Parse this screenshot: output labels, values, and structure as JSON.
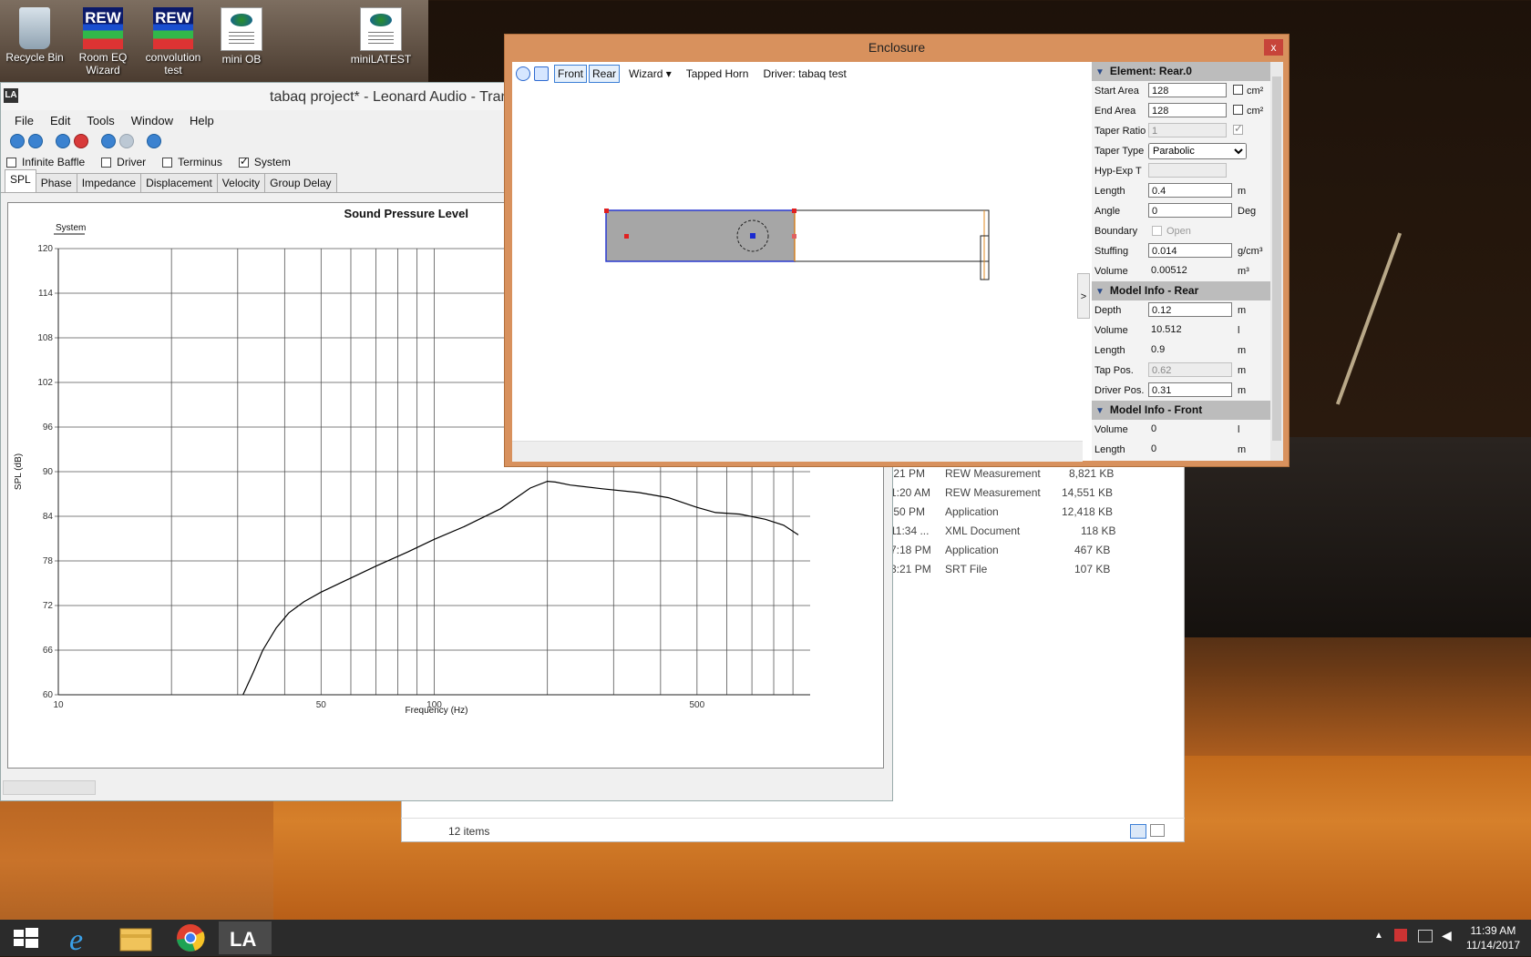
{
  "desktop": {
    "icons": [
      {
        "label": "Recycle Bin",
        "icon": "recycle-bin-icon"
      },
      {
        "label": "Room EQ Wizard",
        "icon": "rew-icon",
        "badge": "REW"
      },
      {
        "label": "convolution test",
        "icon": "rew-icon",
        "badge": "REW"
      },
      {
        "label": "mini OB",
        "icon": "xml-document-icon"
      },
      {
        "label": "miniLATEST",
        "icon": "xml-document-icon"
      }
    ]
  },
  "main_window": {
    "title": "tabaq project* - Leonard Audio - Trans",
    "app_icon_text": "LA",
    "menu": [
      "File",
      "Edit",
      "Tools",
      "Window",
      "Help"
    ],
    "checkboxes": [
      {
        "label": "Infinite Baffle",
        "checked": false
      },
      {
        "label": "Driver",
        "checked": false
      },
      {
        "label": "Terminus",
        "checked": false
      },
      {
        "label": "System",
        "checked": true
      }
    ],
    "tabs": [
      "SPL",
      "Phase",
      "Impedance",
      "Displacement",
      "Velocity",
      "Group Delay"
    ],
    "active_tab": "SPL",
    "chart": {
      "title": "Sound Pressure Level",
      "legend": "System",
      "ylabel": "SPL (dB)",
      "xlabel": "Frequency (Hz)"
    }
  },
  "chart_data": {
    "type": "line",
    "title": "Sound Pressure Level",
    "xlabel": "Frequency (Hz)",
    "ylabel": "SPL (dB)",
    "xscale": "log",
    "xlim": [
      10,
      1000
    ],
    "ylim": [
      60,
      120
    ],
    "yticks": [
      60,
      66,
      72,
      78,
      84,
      90,
      96,
      102,
      108,
      114,
      120
    ],
    "xtick_labels": [
      "10",
      "50",
      "100",
      "500"
    ],
    "legend_position": "top-left",
    "grid": true,
    "series": [
      {
        "name": "System",
        "color": "#000000",
        "x": [
          31,
          33,
          35,
          38,
          41,
          45,
          50,
          60,
          70,
          85,
          100,
          120,
          150,
          180,
          200,
          210,
          230,
          280,
          350,
          420,
          500,
          560,
          650,
          760,
          850,
          930
        ],
        "y": [
          60,
          63,
          66,
          69,
          71,
          72.5,
          73.8,
          75.7,
          77.3,
          79.2,
          80.9,
          82.6,
          85,
          87.8,
          88.7,
          88.6,
          88.2,
          87.7,
          87.2,
          86.5,
          85.2,
          84.5,
          84.3,
          83.6,
          82.8,
          81.5
        ]
      }
    ]
  },
  "enclosure": {
    "title": "Enclosure",
    "close": "x",
    "toolbar": {
      "front": "Front",
      "rear": "Rear",
      "wizard": "Wizard",
      "tapped_horn": "Tapped Horn",
      "driver": "Driver: tabaq test"
    },
    "collapse": ">",
    "element_section": "Element: Rear.0",
    "element_props": [
      {
        "label": "Start Area",
        "value": "128",
        "unit": "cm²",
        "checkbox": true,
        "checked": false
      },
      {
        "label": "End Area",
        "value": "128",
        "unit": "cm²",
        "checkbox": true,
        "checked": false
      },
      {
        "label": "Taper Ratio",
        "value": "1",
        "readonly": true,
        "checkbox": true,
        "checked": true
      },
      {
        "label": "Taper Type",
        "value": "Parabolic",
        "select": true
      },
      {
        "label": "Hyp-Exp T",
        "value": "",
        "readonly": true
      },
      {
        "label": "Length",
        "value": "0.4",
        "unit": "m"
      },
      {
        "label": "Angle",
        "value": "0",
        "unit": "Deg"
      },
      {
        "label": "Boundary",
        "value": "Open",
        "boundary": true
      },
      {
        "label": "Stuffing",
        "value": "0.014",
        "unit": "g/cm³"
      },
      {
        "label": "Volume",
        "value": "0.00512",
        "unit": "m³",
        "plain": true
      }
    ],
    "rear_section": "Model Info - Rear",
    "rear_props": [
      {
        "label": "Depth",
        "value": "0.12",
        "unit": "m"
      },
      {
        "label": "Volume",
        "value": "10.512",
        "unit": "l",
        "plain": true
      },
      {
        "label": "Length",
        "value": "0.9",
        "unit": "m",
        "plain": true
      },
      {
        "label": "Tap Pos.",
        "value": "0.62",
        "unit": "m",
        "readonly": true
      },
      {
        "label": "Driver Pos.",
        "value": "0.31",
        "unit": "m"
      }
    ],
    "front_section": "Model Info - Front",
    "front_props": [
      {
        "label": "Volume",
        "value": "0",
        "unit": "l",
        "plain": true
      },
      {
        "label": "Length",
        "value": "0",
        "unit": "m",
        "plain": true
      }
    ]
  },
  "explorer": {
    "rows": [
      {
        "time": ":21 PM",
        "type": "REW Measurement",
        "size": "8,821 KB"
      },
      {
        "time": "1:20 AM",
        "type": "REW Measurement",
        "size": "14,551 KB"
      },
      {
        "time": ":50 PM",
        "type": "Application",
        "size": "12,418 KB"
      },
      {
        "time": "11:34 ...",
        "type": "XML Document",
        "size": "118 KB"
      },
      {
        "time": "7:18 PM",
        "type": "Application",
        "size": "467 KB"
      },
      {
        "time": "3:21 PM",
        "type": "SRT File",
        "size": "107 KB"
      }
    ],
    "item_count": "12 items"
  },
  "taskbar": {
    "apps": [
      "windows-start-icon",
      "internet-explorer-icon",
      "file-explorer-icon",
      "chrome-icon",
      "leonard-audio-icon"
    ],
    "time": "11:39 AM",
    "date": "11/14/2017"
  }
}
